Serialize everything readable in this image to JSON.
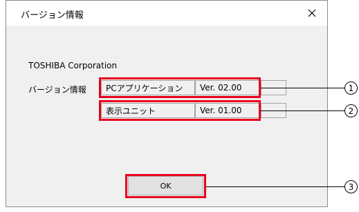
{
  "window": {
    "title": "バージョン情報",
    "close_glyph": "✕"
  },
  "content": {
    "company": "TOSHIBA Corporation",
    "version_label": "バージョン情報",
    "rows": [
      {
        "name": "PCアプリケーション",
        "version": "Ver. 02.00"
      },
      {
        "name": "表示ユニット",
        "version": "Ver. 01.00"
      }
    ]
  },
  "buttons": {
    "ok_label": "OK"
  },
  "callouts": {
    "one": "1",
    "two": "2",
    "three": "3"
  },
  "colors": {
    "highlight": "#e8001c",
    "window_bg": "#f0f0f0",
    "titlebar_bg": "#ffffff"
  },
  "icons": {
    "close": "close-icon"
  }
}
